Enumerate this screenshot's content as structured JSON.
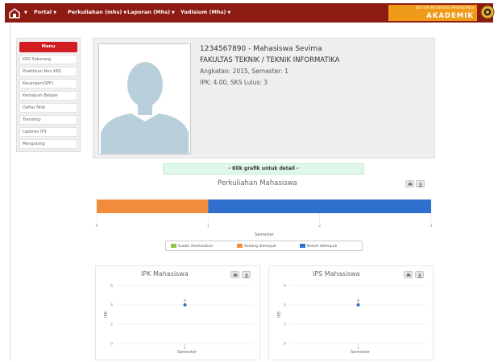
{
  "nav": {
    "items": [
      {
        "label": "Portal"
      },
      {
        "label": "Perkuliahan (mhs)"
      },
      {
        "label": "Laporan (Mhs)"
      },
      {
        "label": "Yudisium (Mhs)"
      }
    ]
  },
  "brand": {
    "subtitle": "SISTEM INFORMASI MANAJEMEN",
    "title": "AKADEMIK"
  },
  "menu": {
    "header": "Menu",
    "items": [
      {
        "label": "KRS Sekarang"
      },
      {
        "label": "Praktikum Non KRS"
      },
      {
        "label": "Keuangan(SPP)"
      },
      {
        "label": "Kemajuan Belajar"
      },
      {
        "label": "Daftar Nilai"
      },
      {
        "label": "Transkrip"
      },
      {
        "label": "Laporan IPS"
      },
      {
        "label": "Mengulang"
      }
    ]
  },
  "profile": {
    "id_name": "1234567890 - Mahasiswa Sevima",
    "faculty": "FAKULTAS TEKNIK / TEKNIK INFORMATIKA",
    "angkatan": "Angkatan: 2015, Semester: 1",
    "ipk": "IPK: 4.00, SKS Lulus: 3"
  },
  "hint": "- Klik grafik untuk detail -",
  "colors": {
    "topbar": "#8c1b12",
    "brand": "#f09a1a",
    "menu_header": "#d11d22",
    "done": "#8dc63f",
    "ongoing": "#f08c3c",
    "not_taken": "#2f6fcd"
  },
  "chart_data": [
    {
      "type": "bar",
      "orientation": "horizontal",
      "stacked": true,
      "title": "Perkuliahan Mahasiswa",
      "xlabel": "Semester",
      "xlim": [
        0,
        3
      ],
      "xticks": [
        "0",
        "1",
        "2",
        "3"
      ],
      "series": [
        {
          "name": "Sudah diselesaikan",
          "color": "#8dc63f",
          "values": [
            0
          ]
        },
        {
          "name": "Sedang ditempuh",
          "color": "#f08c3c",
          "values": [
            1
          ]
        },
        {
          "name": "Belum ditempuh",
          "color": "#2f6fcd",
          "values": [
            2
          ]
        }
      ],
      "legend": "bottom"
    },
    {
      "type": "scatter",
      "title": "IPK Mahasiswa",
      "xlabel": "Semester",
      "ylabel": "IPK",
      "ylim": [
        0,
        6
      ],
      "yticks": [
        "0",
        "2",
        "4",
        "6"
      ],
      "xticks": [
        "1"
      ],
      "points": [
        {
          "x": 1,
          "y": 4,
          "label": "4"
        }
      ]
    },
    {
      "type": "scatter",
      "title": "IPS Mahasiswa",
      "xlabel": "Semester",
      "ylabel": "IPS",
      "ylim": [
        0,
        6
      ],
      "yticks": [
        "0",
        "2",
        "4",
        "6"
      ],
      "xticks": [
        "1"
      ],
      "points": [
        {
          "x": 1,
          "y": 4,
          "label": "4"
        }
      ]
    }
  ]
}
